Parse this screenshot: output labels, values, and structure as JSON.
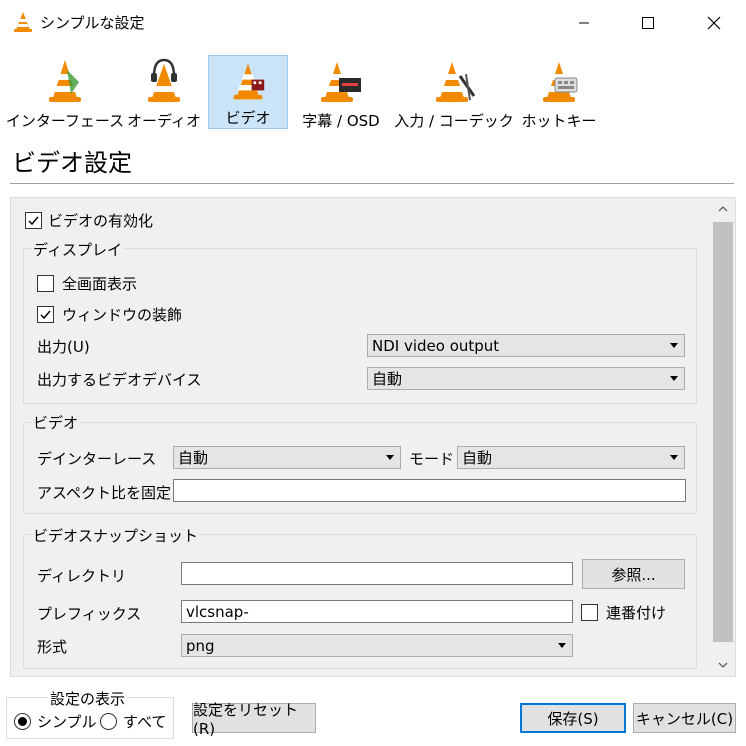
{
  "window": {
    "title": "シンプルな設定"
  },
  "toolbar": {
    "categories": [
      {
        "label": "インターフェース",
        "icon": "vlc-cone-interface-icon"
      },
      {
        "label": "オーディオ",
        "icon": "vlc-cone-audio-icon"
      },
      {
        "label": "ビデオ",
        "icon": "vlc-cone-video-icon",
        "selected": true
      },
      {
        "label": "字幕 / OSD",
        "icon": "vlc-cone-subtitles-icon"
      },
      {
        "label": "入力 / コーデック",
        "icon": "vlc-cone-input-codec-icon"
      },
      {
        "label": "ホットキー",
        "icon": "vlc-cone-hotkeys-icon"
      }
    ]
  },
  "page": {
    "title": "ビデオ設定"
  },
  "video": {
    "enable_label": "ビデオの有効化",
    "enable_checked": true,
    "display": {
      "title": "ディスプレイ",
      "fullscreen_label": "全画面表示",
      "fullscreen_checked": false,
      "decorations_label": "ウィンドウの装飾",
      "decorations_checked": true,
      "output_label": "出力(U)",
      "output_value": "NDI video output",
      "device_label": "出力するビデオデバイス",
      "device_value": "自動"
    },
    "video_group": {
      "title": "ビデオ",
      "deinterlace_label": "デインターレース",
      "deinterlace_value": "自動",
      "mode_label": "モード",
      "mode_value": "自動",
      "aspect_label": "アスペクト比を固定",
      "aspect_value": ""
    },
    "snapshot": {
      "title": "ビデオスナップショット",
      "directory_label": "ディレクトリ",
      "directory_value": "",
      "browse_label": "参照...",
      "prefix_label": "プレフィックス",
      "prefix_value": "vlcsnap-",
      "sequential_label": "連番付け",
      "sequential_checked": false,
      "format_label": "形式",
      "format_value": "png"
    }
  },
  "footer": {
    "show_settings_label": "設定の表示",
    "simple_label": "シンプル",
    "all_label": "すべて",
    "selected_mode": "simple",
    "reset_label": "設定をリセット(R)",
    "save_label": "保存(S)",
    "cancel_label": "キャンセル(C)"
  },
  "colors": {
    "selection_bg": "#cce4f7",
    "accent": "#0078d7",
    "cone_orange": "#f28a00"
  }
}
